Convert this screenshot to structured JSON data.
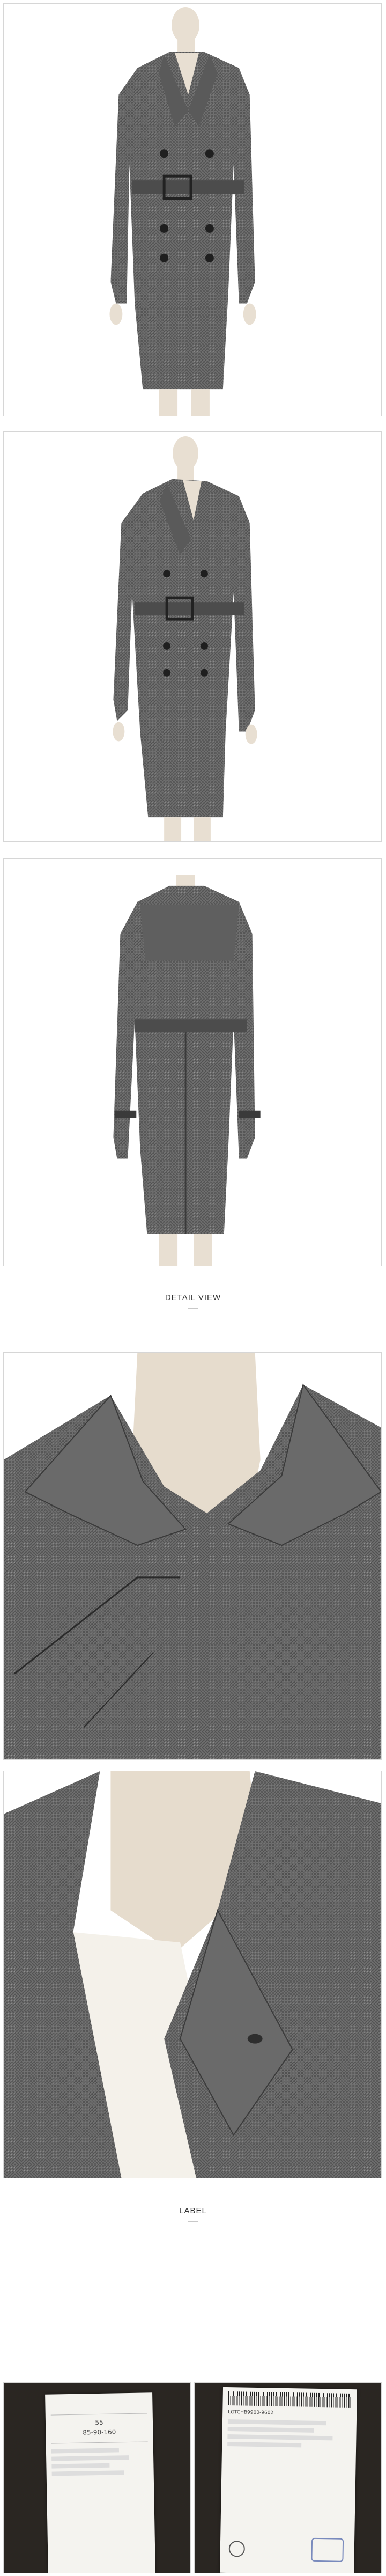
{
  "sections": {
    "detail_title": "DETAIL VIEW",
    "label_title": "LABEL"
  },
  "colors": {
    "fabric": "#6f6f6f",
    "fabric_dark": "#3a3a3a",
    "mannequin": "#e6dccd",
    "background": "#ffffff"
  },
  "label_left": {
    "lines": [
      "55",
      "85-90-160"
    ]
  },
  "label_right": {
    "lines": [
      "LGTCHB9900-9602"
    ]
  }
}
